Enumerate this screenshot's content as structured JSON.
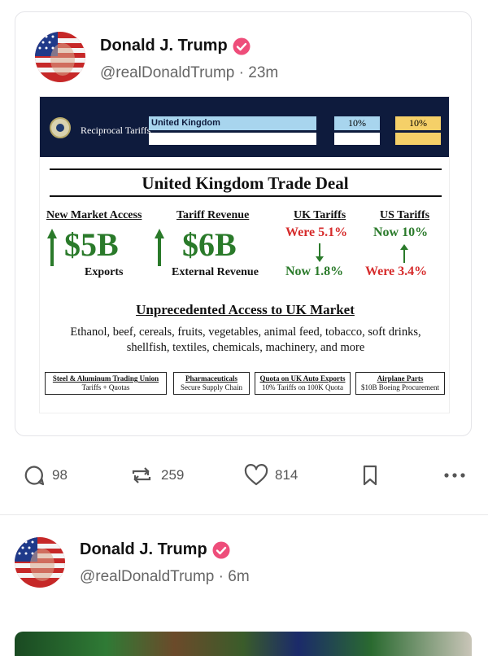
{
  "post1": {
    "author": "Donald J. Trump",
    "handle": "@realDonaldTrump",
    "time": "· 23m",
    "graphic": {
      "banner_label": "Reciprocal Tariffs",
      "country": "United Kingdom",
      "pct1": "10%",
      "pct2": "10%",
      "title": "United Kingdom Trade Deal",
      "columns": {
        "market_access": {
          "head": "New Market Access",
          "value": "$5B",
          "sub": "Exports"
        },
        "tariff_revenue": {
          "head": "Tariff Revenue",
          "value": "$6B",
          "sub": "External Revenue"
        },
        "uk_tariffs": {
          "head": "UK Tariffs",
          "top": "Were 5.1%",
          "bottom": "Now 1.8%"
        },
        "us_tariffs": {
          "head": "US Tariffs",
          "top": "Now 10%",
          "bottom": "Were 3.4%"
        }
      },
      "access_title": "Unprecedented Access to UK Market",
      "access_text": "Ethanol, beef, cereals, fruits, vegetables, animal feed, tobacco, soft drinks, shellfish, textiles, chemicals, machinery, and more",
      "boxes": [
        {
          "title": "Steel & Aluminum Trading Union",
          "sub": "Tariffs + Quotas"
        },
        {
          "title": "Pharmaceuticals",
          "sub": "Secure Supply Chain"
        },
        {
          "title": "Quota on UK Auto Exports",
          "sub": "10% Tariffs on 100K Quota"
        },
        {
          "title": "Airplane Parts",
          "sub": "$10B Boeing Procurement"
        }
      ]
    }
  },
  "actions": {
    "replies": "98",
    "reposts": "259",
    "likes": "814"
  },
  "post2": {
    "author": "Donald J. Trump",
    "handle": "@realDonaldTrump",
    "time": "· 6m"
  },
  "colors": {
    "badge": "#ee4d7a",
    "banner": "#0e1b3d",
    "green": "#2a7a2a",
    "red": "#d62b2b"
  },
  "icons": [
    "reply-icon",
    "repost-icon",
    "like-icon",
    "bookmark-icon",
    "more-icon",
    "verified-badge-icon"
  ]
}
